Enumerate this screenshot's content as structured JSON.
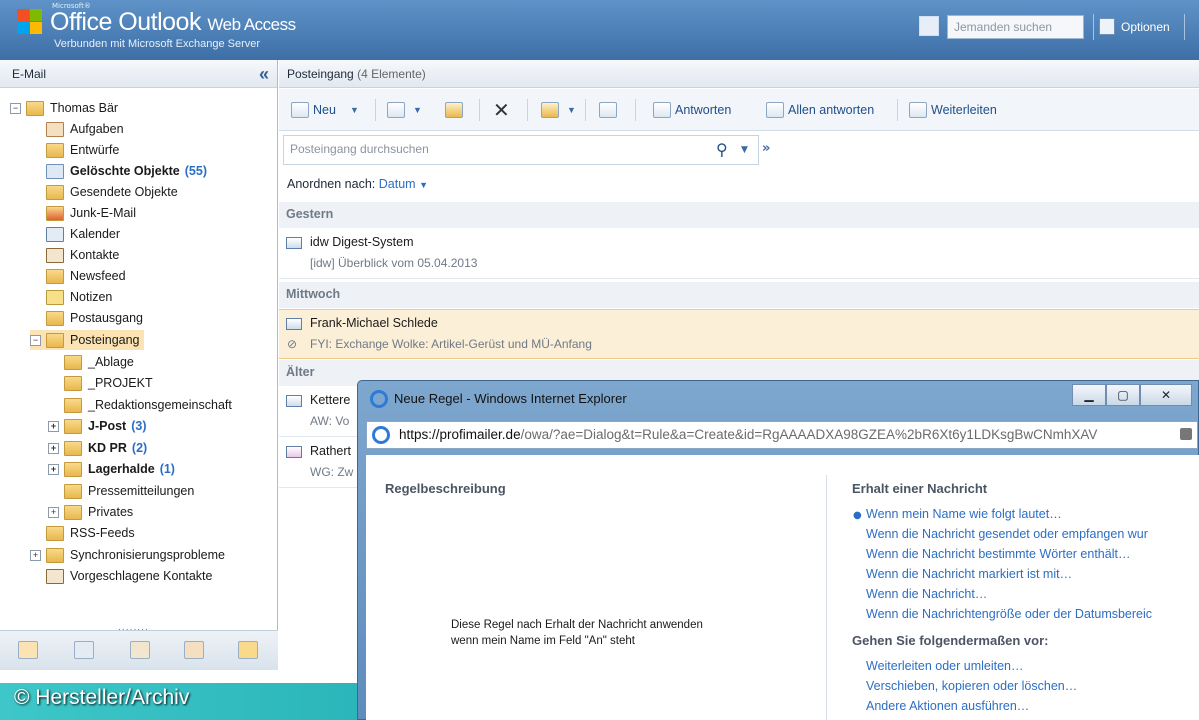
{
  "header": {
    "microsoft_label": "Microsoft®",
    "app_name": "Office Outlook",
    "app_suffix": "Web Access",
    "connection": "Verbunden mit Microsoft Exchange Server",
    "find_placeholder": "Jemanden suchen",
    "options_label": "Optionen"
  },
  "sidebar": {
    "title": "E-Mail",
    "collapse": "«",
    "items": [
      {
        "label": "Thomas Bär"
      },
      {
        "label": "Aufgaben"
      },
      {
        "label": "Entwürfe"
      },
      {
        "label": "Gelöschte Objekte",
        "count": "(55)"
      },
      {
        "label": "Gesendete Objekte"
      },
      {
        "label": "Junk-E-Mail"
      },
      {
        "label": "Kalender"
      },
      {
        "label": "Kontakte"
      },
      {
        "label": "Newsfeed"
      },
      {
        "label": "Notizen"
      },
      {
        "label": "Postausgang"
      },
      {
        "label": "Posteingang"
      },
      {
        "label": "_Ablage"
      },
      {
        "label": "_PROJEKT"
      },
      {
        "label": "_Redaktionsgemeinschaft"
      },
      {
        "label": "J-Post",
        "count": "(3)"
      },
      {
        "label": "KD PR",
        "count": "(2)"
      },
      {
        "label": "Lagerhalde",
        "count": "(1)"
      },
      {
        "label": "Pressemitteilungen"
      },
      {
        "label": "Privates"
      },
      {
        "label": "RSS-Feeds"
      },
      {
        "label": "Synchronisierungsprobleme"
      },
      {
        "label": "Vorgeschlagene Kontakte"
      }
    ],
    "grip": "........"
  },
  "main": {
    "title": "Posteingang",
    "count": "(4 Elemente)",
    "toolbar": {
      "new": "Neu",
      "reply": "Antworten",
      "reply_all": "Allen antworten",
      "forward": "Weiterleiten",
      "delete": "✕"
    },
    "search_placeholder": "Posteingang durchsuchen",
    "sort_label": "Anordnen nach:",
    "sort_value": "Datum",
    "groups": [
      "Gestern",
      "Mittwoch",
      "Älter"
    ],
    "messages": [
      {
        "from": "idw Digest-System",
        "subject": "[idw] Überblick vom 05.04.2013"
      },
      {
        "from": "Frank-Michael Schlede",
        "subject": "FYI: Exchange Wolke: Artikel-Gerüst und MÜ-Anfang"
      },
      {
        "from": "Kettere",
        "subject": "AW: Vo"
      },
      {
        "from": "Rathert",
        "subject": "WG: Zw"
      }
    ]
  },
  "dialog": {
    "title": "Neue Regel - Windows Internet Explorer",
    "url_prefix": "https://",
    "url_host": "profimailer.de",
    "url_rest": "/owa/?ae=Dialog&t=Rule&a=Create&id=RgAAAADXA98GZEA%2bR6Xt6y1LDKsgBwCNmhXAV",
    "rule_desc_title": "Regelbeschreibung",
    "rule_text_1": "Diese Regel nach Erhalt der Nachricht anwenden",
    "rule_text_2": "wenn mein Name im Feld \"An\" steht",
    "conditions_title": "Erhalt einer Nachricht",
    "conditions": [
      "Wenn mein Name wie folgt lautet…",
      "Wenn die Nachricht gesendet oder empfangen wur",
      "Wenn die Nachricht bestimmte Wörter enthält…",
      "Wenn die Nachricht markiert ist mit…",
      "Wenn die Nachricht…",
      "Wenn die Nachrichtengröße oder der Datumsbereic"
    ],
    "actions_title": "Gehen Sie folgendermaßen vor:",
    "actions": [
      "Weiterleiten oder umleiten…",
      "Verschieben, kopieren oder löschen…",
      "Andere Aktionen ausführen…"
    ]
  },
  "credit": "© Hersteller/Archiv"
}
